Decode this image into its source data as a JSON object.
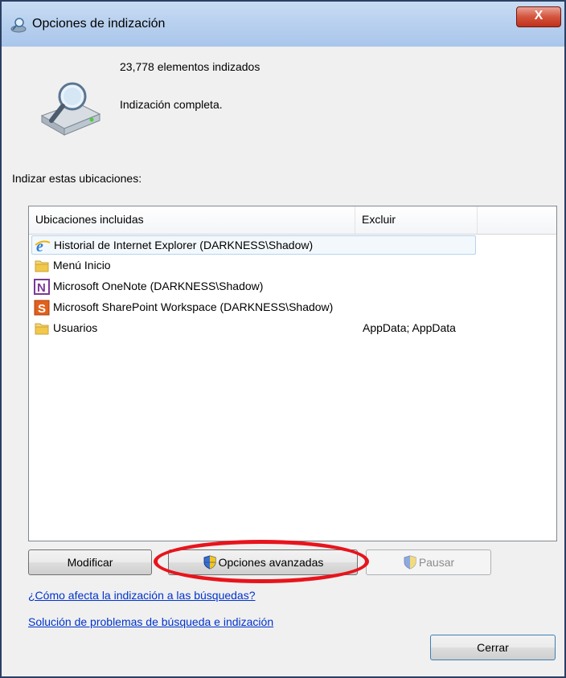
{
  "window": {
    "title": "Opciones de indización",
    "close_label": "X"
  },
  "summary": {
    "count_text": "23,778 elementos indizados",
    "status_text": "Indización completa."
  },
  "section_label": "Indizar estas ubicaciones:",
  "list": {
    "columns": [
      "Ubicaciones incluidas",
      "Excluir"
    ],
    "rows": [
      {
        "icon": "internet-explorer-icon",
        "name": "Historial de Internet Explorer (DARKNESS\\Shadow)",
        "exclude": ""
      },
      {
        "icon": "folder-icon",
        "name": "Menú Inicio",
        "exclude": ""
      },
      {
        "icon": "onenote-icon",
        "name": "Microsoft OneNote (DARKNESS\\Shadow)",
        "exclude": ""
      },
      {
        "icon": "sharepoint-icon",
        "name": "Microsoft SharePoint Workspace (DARKNESS\\Shadow)",
        "exclude": ""
      },
      {
        "icon": "folder-icon",
        "name": "Usuarios",
        "exclude": "AppData; AppData"
      }
    ]
  },
  "buttons": {
    "modify": "Modificar",
    "advanced": "Opciones avanzadas",
    "pause": "Pausar",
    "close": "Cerrar"
  },
  "links": {
    "how_affects": "¿Cómo afecta la indización a las búsquedas?",
    "troubleshoot": "Solución de problemas de búsqueda e indización"
  },
  "colors": {
    "highlight_ellipse": "#e8141c",
    "link": "#0033cc",
    "selection": "#f3f8fd"
  }
}
